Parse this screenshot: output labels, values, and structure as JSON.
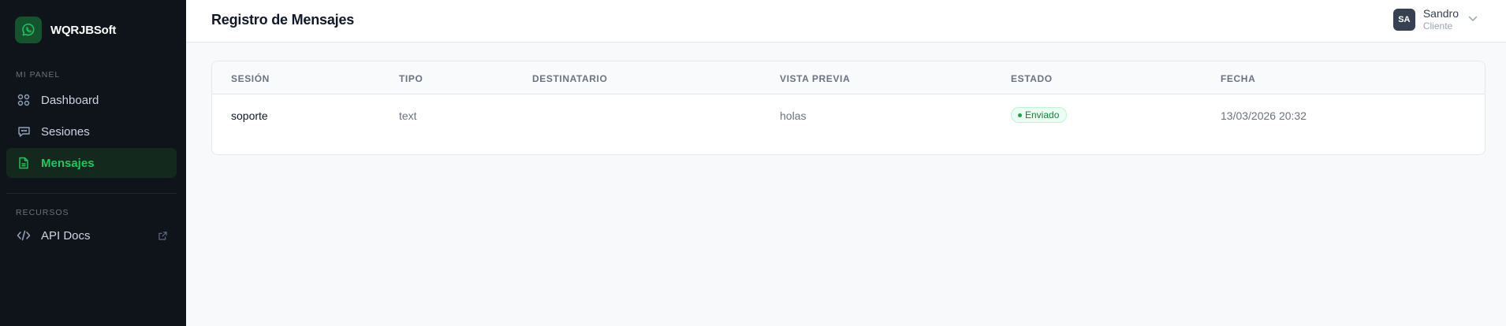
{
  "app": {
    "name": "WQRJBSoft"
  },
  "sidebar": {
    "sections": [
      {
        "label": "MI PANEL"
      },
      {
        "label": "RECURSOS"
      }
    ],
    "items": [
      {
        "label": "Dashboard",
        "icon": "grid-icon",
        "active": false
      },
      {
        "label": "Sesiones",
        "icon": "chat-icon",
        "active": false
      },
      {
        "label": "Mensajes",
        "icon": "document-icon",
        "active": true
      },
      {
        "label": "API Docs",
        "icon": "code-icon",
        "active": false,
        "external": true
      }
    ]
  },
  "header": {
    "title": "Registro de Mensajes",
    "user": {
      "initials": "SA",
      "name": "Sandro",
      "role": "Cliente"
    }
  },
  "table": {
    "columns": [
      "SESIÓN",
      "TIPO",
      "DESTINATARIO",
      "VISTA PREVIA",
      "ESTADO",
      "FECHA"
    ],
    "rows": [
      {
        "session": "soporte",
        "type": "text",
        "recipient": "",
        "preview": "holas",
        "status": "Enviado",
        "date": "13/03/2026 20:32"
      }
    ]
  },
  "colors": {
    "accent": "#22c55e",
    "sidebar_bg": "#0f131a",
    "status_success": "#15803d"
  }
}
